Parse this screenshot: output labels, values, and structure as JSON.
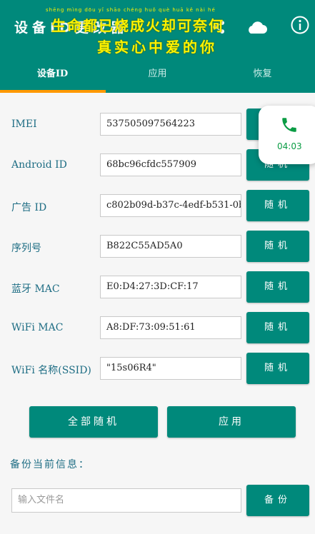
{
  "header": {
    "title": "设备ID更改器",
    "overlay_pinyin": "shēng mìng dōu yǐ shāo chéng huǒ què huā kě nài hé",
    "overlay_line1": "生命都已烧成火却可奈何",
    "overlay_line2": "真实心中爱的你"
  },
  "tabs": [
    {
      "label": "设备ID",
      "active": true
    },
    {
      "label": "应用",
      "active": false
    },
    {
      "label": "恢复",
      "active": false
    }
  ],
  "rows": [
    {
      "label": "IMEI",
      "value": "537505097564223",
      "button": "随机"
    },
    {
      "label": "Android ID",
      "value": "68bc96cfdc557909",
      "button": "随机"
    },
    {
      "label": "广告 ID",
      "value": "c802b09d-b37c-4edf-b531-0b",
      "button": "随机"
    },
    {
      "label": "序列号",
      "value": "B822C55AD5A0",
      "button": "随机"
    },
    {
      "label": "蓝牙 MAC",
      "value": "E0:D4:27:3D:CF:17",
      "button": "随机"
    },
    {
      "label": "WiFi MAC",
      "value": "A8:DF:73:09:51:61",
      "button": "随机"
    },
    {
      "label": "WiFi 名称(SSID)",
      "value": "\"15s06R4\"",
      "button": "随机"
    }
  ],
  "actions": {
    "random_all": "全部随机",
    "apply": "应用"
  },
  "backup": {
    "section_label": "备份当前信息：",
    "filename_placeholder": "输入文件名",
    "button": "备份"
  },
  "call_float": {
    "time": "04:03"
  },
  "colors": {
    "primary": "#00897b",
    "tab_indicator": "#ff9800",
    "label": "#1e6d84",
    "call_green": "#0a9c44"
  }
}
